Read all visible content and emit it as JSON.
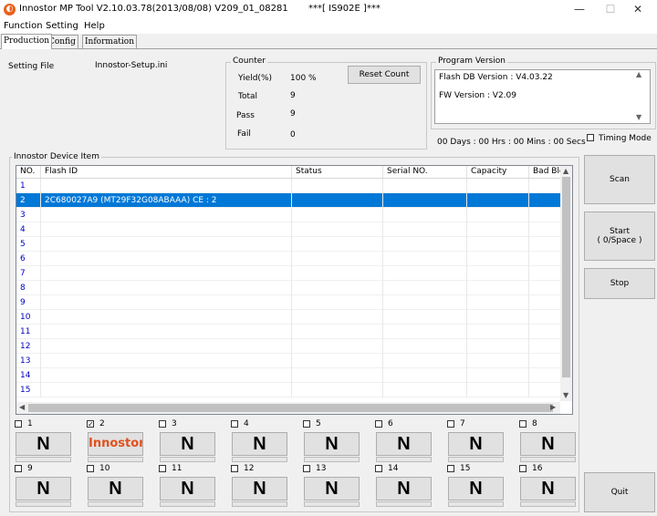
{
  "window": {
    "title": "Innostor MP Tool V2.10.03.78(2013/08/08)    V209_01_08281",
    "center_title": "***[ IS902E ]***",
    "min": "—",
    "max": "☐",
    "close": "✕"
  },
  "menu": [
    "Function",
    "Setting",
    "Help"
  ],
  "tabs": [
    "Production",
    "Config",
    "Information"
  ],
  "setting": {
    "label": "Setting File",
    "value": "Innostor-Setup.ini"
  },
  "counter": {
    "title": "Counter",
    "yield_label": "Yield(%)",
    "yield_value": "100 %",
    "total_label": "Total",
    "total_value": "9",
    "pass_label": "Pass",
    "pass_value": "9",
    "fail_label": "Fail",
    "fail_value": "0",
    "reset_label": "Reset Count"
  },
  "program_version": {
    "title": "Program Version",
    "flash_db": "Flash DB Version :  V4.03.22",
    "fw": "FW Version :    V2.09"
  },
  "timer": "00 Days : 00 Hrs : 00 Mins : 00 Secs",
  "timing_mode": "Timing Mode",
  "device_group_title": "Innostor Device Item",
  "columns": [
    "NO.",
    "Flash ID",
    "Status",
    "Serial NO.",
    "Capacity",
    "Bad Blo"
  ],
  "rows": [
    {
      "no": "1",
      "flash_id": "",
      "selected": false
    },
    {
      "no": "2",
      "flash_id": "2C680027A9 (MT29F32G08ABAAA) CE : 2",
      "selected": true
    },
    {
      "no": "3",
      "flash_id": "",
      "selected": false
    },
    {
      "no": "4",
      "flash_id": "",
      "selected": false
    },
    {
      "no": "5",
      "flash_id": "",
      "selected": false
    },
    {
      "no": "6",
      "flash_id": "",
      "selected": false
    },
    {
      "no": "7",
      "flash_id": "",
      "selected": false
    },
    {
      "no": "8",
      "flash_id": "",
      "selected": false
    },
    {
      "no": "9",
      "flash_id": "",
      "selected": false
    },
    {
      "no": "10",
      "flash_id": "",
      "selected": false
    },
    {
      "no": "11",
      "flash_id": "",
      "selected": false
    },
    {
      "no": "12",
      "flash_id": "",
      "selected": false
    },
    {
      "no": "13",
      "flash_id": "",
      "selected": false
    },
    {
      "no": "14",
      "flash_id": "",
      "selected": false
    },
    {
      "no": "15",
      "flash_id": "",
      "selected": false
    }
  ],
  "buttons": {
    "scan": "Scan",
    "start": "Start\n( 0/Space )",
    "stop": "Stop",
    "quit": "Quit"
  },
  "devices": [
    {
      "no": "1",
      "checked": false,
      "text": "N"
    },
    {
      "no": "2",
      "checked": true,
      "text": "Innostor"
    },
    {
      "no": "3",
      "checked": false,
      "text": "N"
    },
    {
      "no": "4",
      "checked": false,
      "text": "N"
    },
    {
      "no": "5",
      "checked": false,
      "text": "N"
    },
    {
      "no": "6",
      "checked": false,
      "text": "N"
    },
    {
      "no": "7",
      "checked": false,
      "text": "N"
    },
    {
      "no": "8",
      "checked": false,
      "text": "N"
    },
    {
      "no": "9",
      "checked": false,
      "text": "N"
    },
    {
      "no": "10",
      "checked": false,
      "text": "N"
    },
    {
      "no": "11",
      "checked": false,
      "text": "N"
    },
    {
      "no": "12",
      "checked": false,
      "text": "N"
    },
    {
      "no": "13",
      "checked": false,
      "text": "N"
    },
    {
      "no": "14",
      "checked": false,
      "text": "N"
    },
    {
      "no": "15",
      "checked": false,
      "text": "N"
    },
    {
      "no": "16",
      "checked": false,
      "text": "N"
    }
  ],
  "colors": {
    "selection": "#0078d7",
    "brand": "#e0501c",
    "row_number": "#0000c0"
  }
}
